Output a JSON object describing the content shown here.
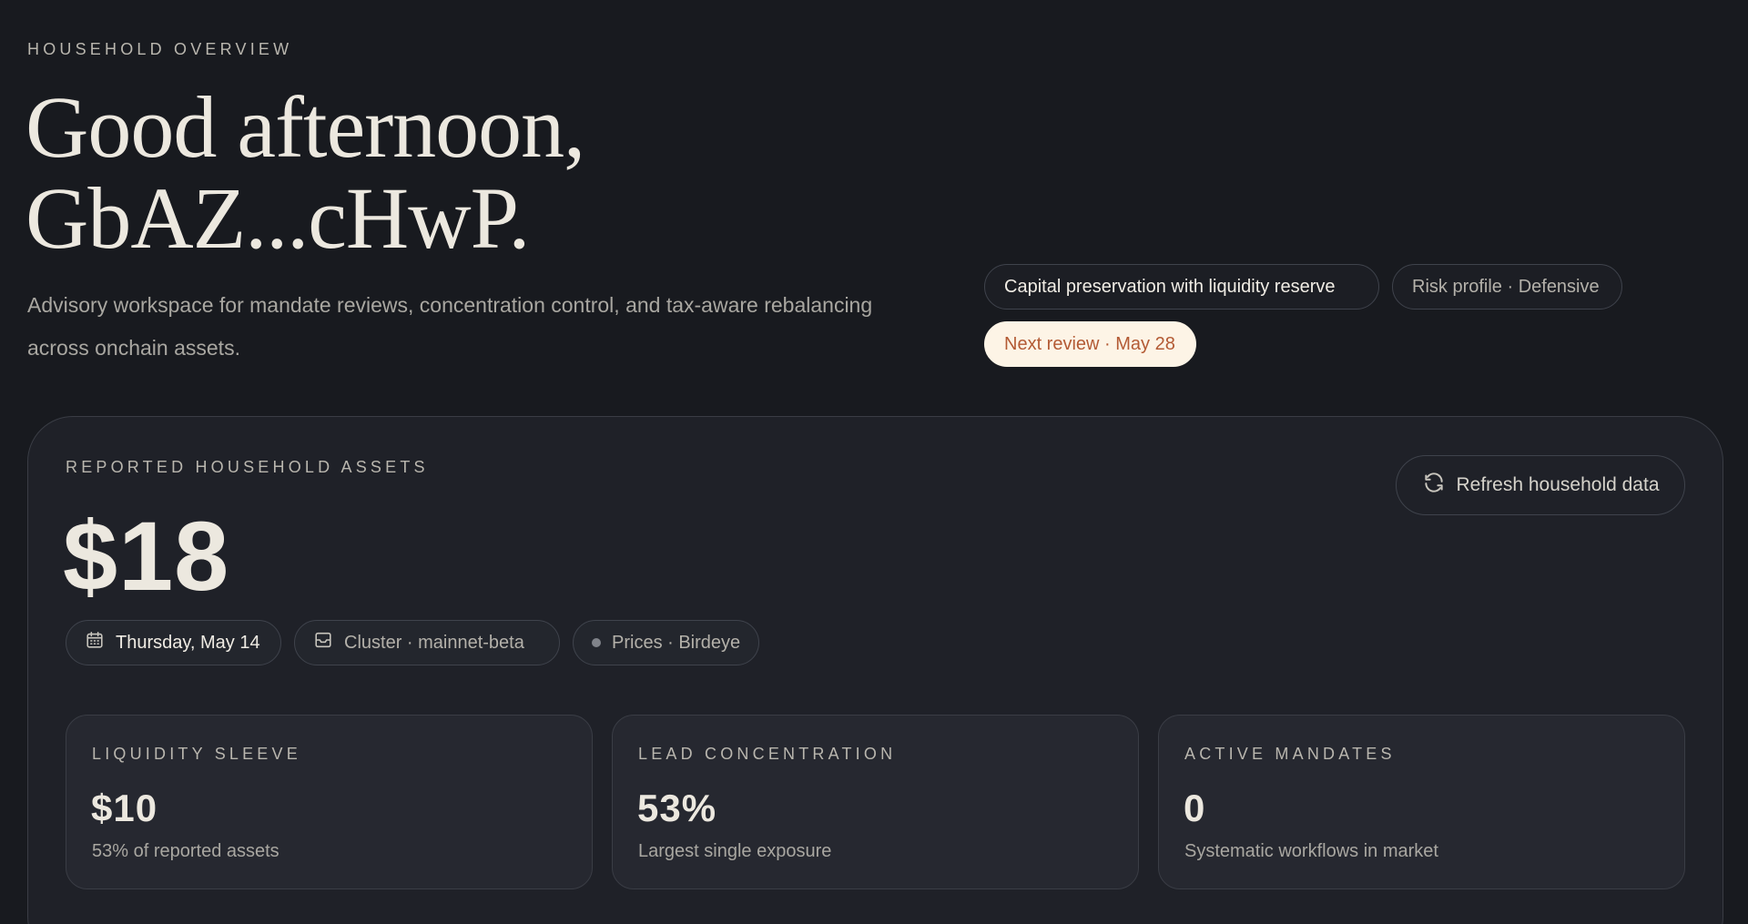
{
  "header": {
    "eyebrow": "HOUSEHOLD OVERVIEW",
    "greeting_line1": "Good afternoon,",
    "greeting_line2": "GbAZ...cHwP.",
    "subtitle": "Advisory workspace for mandate reviews, concentration control, and tax-aware rebalancing across onchain assets."
  },
  "tags": {
    "mandate": "Capital preservation with liquidity reserve",
    "risk": "Risk profile · Defensive",
    "review": "Next review · May 28"
  },
  "summary": {
    "eyebrow": "REPORTED HOUSEHOLD ASSETS",
    "total": "$18",
    "refresh_label": "Refresh household data",
    "meta": {
      "date": "Thursday, May 14",
      "cluster": "Cluster · mainnet-beta",
      "prices": "Prices · Birdeye"
    }
  },
  "stats": [
    {
      "label": "LIQUIDITY SLEEVE",
      "value": "$10",
      "note": "53% of reported assets"
    },
    {
      "label": "LEAD CONCENTRATION",
      "value": "53%",
      "note": "Largest single exposure"
    },
    {
      "label": "ACTIVE MANDATES",
      "value": "0",
      "note": "Systematic workflows in market"
    }
  ],
  "icons": {
    "refresh": "refresh-icon",
    "calendar": "calendar-icon",
    "cluster": "server-icon",
    "prices": "status-dot"
  },
  "colors": {
    "background": "#181a1f",
    "card": "#1f2128",
    "review_pill_bg": "#fdf4e6",
    "review_pill_text": "#b35a34"
  }
}
